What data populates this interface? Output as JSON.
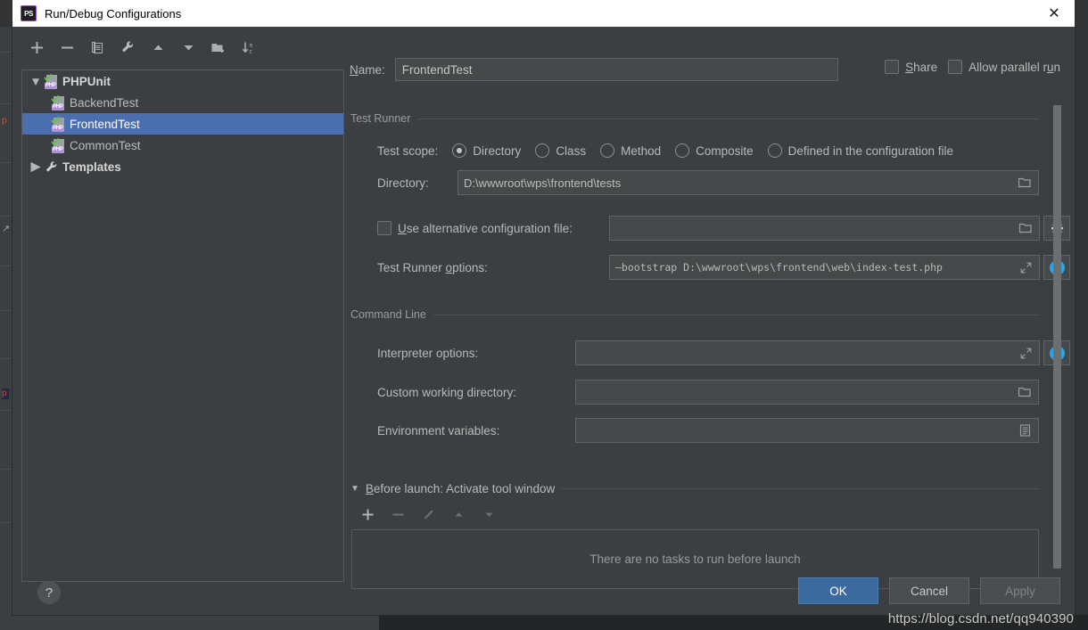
{
  "window": {
    "title": "Run/Debug Configurations",
    "app_icon": "phpstorm-icon",
    "close_label": "✕"
  },
  "tree_toolbar": {
    "buttons": [
      {
        "name": "add-configuration-button",
        "icon": "plus-icon"
      },
      {
        "name": "remove-configuration-button",
        "icon": "minus-icon"
      },
      {
        "name": "copy-configuration-button",
        "icon": "copy-icon"
      },
      {
        "name": "edit-templates-button",
        "icon": "wrench-icon"
      },
      {
        "name": "move-up-button",
        "icon": "arrow-up-icon"
      },
      {
        "name": "move-down-button",
        "icon": "arrow-down-icon"
      },
      {
        "name": "new-folder-button",
        "icon": "folder-add-icon"
      },
      {
        "name": "sort-alphabetically-button",
        "icon": "sort-az-icon"
      }
    ]
  },
  "tree": {
    "nodes": [
      {
        "label": "PHPUnit",
        "level": 0,
        "icon": "php-test-icon",
        "twisty": "▼",
        "bold": true,
        "selected": false
      },
      {
        "label": "BackendTest",
        "level": 1,
        "icon": "php-test-icon",
        "twisty": "",
        "bold": false,
        "selected": false
      },
      {
        "label": "FrontendTest",
        "level": 1,
        "icon": "php-test-icon",
        "twisty": "",
        "bold": false,
        "selected": true
      },
      {
        "label": "CommonTest",
        "level": 1,
        "icon": "php-test-icon",
        "twisty": "",
        "bold": false,
        "selected": false
      },
      {
        "label": "Templates",
        "level": 0,
        "icon": "wrench-icon",
        "twisty": "▶",
        "bold": true,
        "selected": false
      }
    ]
  },
  "help": {
    "label": "?"
  },
  "name_row": {
    "label": "Name:",
    "label_mnemonic": "N",
    "value": "FrontendTest",
    "share": {
      "label": "Share",
      "mnemonic": "S",
      "checked": false
    },
    "parallel": {
      "label": "Allow parallel run",
      "mnemonic": "u",
      "checked": false
    }
  },
  "test_runner": {
    "group_title": "Test Runner",
    "test_scope_label": "Test scope:",
    "scope_options": [
      {
        "label": "Directory",
        "selected": true
      },
      {
        "label": "Class",
        "selected": false
      },
      {
        "label": "Method",
        "selected": false
      },
      {
        "label": "Composite",
        "selected": false
      },
      {
        "label": "Defined in the configuration file",
        "selected": false
      }
    ],
    "directory_label": "Directory:",
    "directory_value": "D:\\wwwroot\\wps\\frontend\\tests",
    "directory_browse_icon": "folder-icon",
    "alt_config": {
      "label": "Use alternative configuration file:",
      "mnemonic": "U",
      "checked": false,
      "value": "",
      "browse_icon": "folder-icon",
      "settings_icon": "gear-icon"
    },
    "runner_options": {
      "label": "Test Runner options:",
      "mnemonic": "o",
      "value": "—bootstrap D:\\wwwroot\\wps\\frontend\\web\\index-test.php",
      "expand_icon": "expand-icon",
      "info_icon": "info-icon"
    }
  },
  "command_line": {
    "group_title": "Command Line",
    "rows": [
      {
        "label": "Interpreter options:",
        "value": "",
        "trailing_icon": "expand-icon",
        "side_button": "info-icon"
      },
      {
        "label": "Custom working directory:",
        "value": "",
        "trailing_icon": "folder-icon",
        "side_button": ""
      },
      {
        "label": "Environment variables:",
        "value": "",
        "trailing_icon": "env-list-icon",
        "side_button": ""
      }
    ]
  },
  "before_launch": {
    "twisty": "▼",
    "title": "Before launch: Activate tool window",
    "mnemonic": "B",
    "toolbar": [
      {
        "name": "add-task-button",
        "icon": "plus-icon",
        "enabled": true
      },
      {
        "name": "remove-task-button",
        "icon": "minus-icon",
        "enabled": false
      },
      {
        "name": "edit-task-button",
        "icon": "pencil-icon",
        "enabled": false
      },
      {
        "name": "move-task-up-button",
        "icon": "arrow-up-icon",
        "enabled": false
      },
      {
        "name": "move-task-down-button",
        "icon": "arrow-down-icon",
        "enabled": false
      }
    ],
    "empty_text": "There are no tasks to run before launch"
  },
  "footer": {
    "ok": "OK",
    "cancel": "Cancel",
    "apply": "Apply",
    "apply_enabled": false
  },
  "watermark": {
    "text": "https://blog.csdn.net/qq940390"
  },
  "colors": {
    "dialog_bg": "#3c3f41",
    "field_bg": "#45494a",
    "selection_blue": "#4b6eaf",
    "primary_button": "#3c699e",
    "info_blue": "#2fa2e0",
    "php_badge": "#b294d6",
    "titlebar_bg": "#ffffff"
  }
}
